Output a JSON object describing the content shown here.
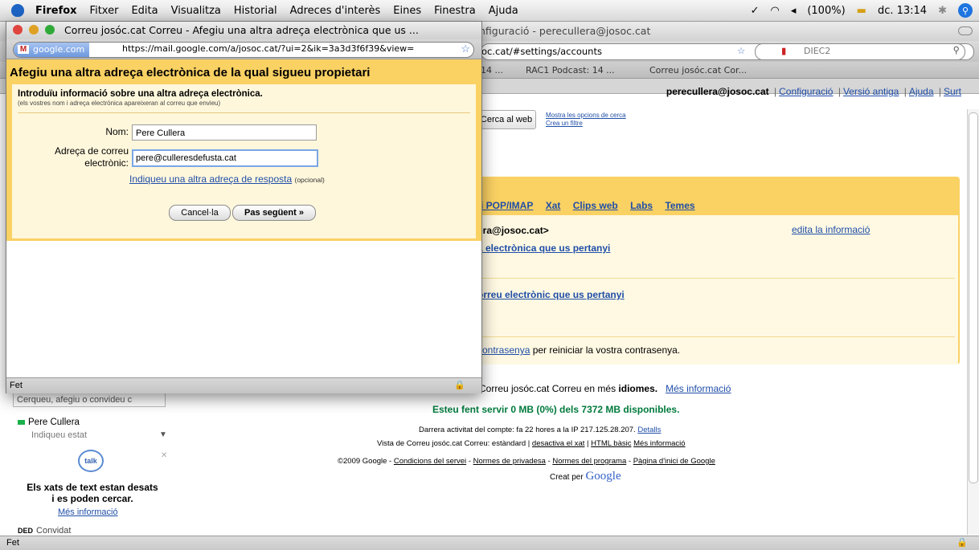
{
  "menubar": {
    "app": "Firefox",
    "items": [
      "Fitxer",
      "Edita",
      "Visualitza",
      "Historial",
      "Adreces d'interès",
      "Eines",
      "Finestra",
      "Ajuda"
    ],
    "battery": "(100%)",
    "clock": "dc. 13:14"
  },
  "back_window": {
    "title_partial": "nfiguració - perecullera@josoc.cat",
    "url_partial": "oc.cat/#settings/accounts",
    "search_placeholder": "DIEC2",
    "bookmarks": [
      "14 ...",
      "RAC1 Podcast: 14 ...",
      "Correu josóc.cat Cor..."
    ],
    "status": "Fet"
  },
  "gmail": {
    "email": "perecullera@josoc.cat",
    "links": [
      "Configuració",
      "Versió antiga",
      "Ajuda",
      "Surt"
    ],
    "search_web_button": "Cerca al web",
    "search_options": [
      "Mostra les opcions de cerca",
      "Crea un filtre"
    ],
    "settings_tabs": [
      "i POP/IMAP",
      "Xat",
      "Clips web",
      "Labs",
      "Temes"
    ],
    "sender_partial": "era@josoc.cat>",
    "edit_info": "edita la informació",
    "add_address_partial": "a electrònica que us pertanyi",
    "add_address2_partial": "orreu electrònic que us pertanyi",
    "password_link": "contrasenya",
    "password_text": " per reiniciar la vostra contrasenya.",
    "language_text": "Correu josóc.cat Correu en més ",
    "language_bold": "idiomes.",
    "more_info": "Més informació",
    "space_text": "Esteu fent servir 0 MB (0%) dels 7372 MB disponibles.",
    "activity_text": "Darrera activitat del compte: fa 22 hores a la IP 217.125.28.207.",
    "details_link": "Detalls",
    "view_text": "Vista de Correu josóc.cat Correu: estàndard |",
    "view_links": [
      "desactiva el xat",
      "HTML bàsic",
      "Més informació"
    ],
    "footer_copyright": "©2009 Google -",
    "footer_links": [
      "Condicions del servei",
      "Normes de privadesa",
      "Normes del programa",
      "Pàgina d'inici de Google"
    ],
    "created_by": "Creat per",
    "google_logo": "Google"
  },
  "chat": {
    "search_placeholder": "Cerqueu, afegiu o convideu c",
    "me": "Pere Cullera",
    "status": "Indiqueu estat",
    "talk": "talk",
    "disabled_line1": "Els xats de text estan desats",
    "disabled_line2": "i es poden cercar.",
    "more_info": "Més informació",
    "invited_tag": "DED",
    "invited": "Convidat"
  },
  "front_window": {
    "title": "Correu josóc.cat Correu - Afegiu una altra adreça electrònica que us ...",
    "site": "google.com",
    "url": "https://mail.google.com/a/josoc.cat/?ui=2&ik=3a3d3f6f39&view=",
    "dialog_title": "Afegiu una altra adreça electrònica de la qual sigueu propietari",
    "intro_heading": "Introduïu informació sobre una altra adreça electrònica.",
    "intro_sub": "(els vostres nom i adreça electrònica apareixeran al correu que envieu)",
    "name_label": "Nom:",
    "name_value": "Pere Cullera",
    "email_label_1": "Adreça de correu",
    "email_label_2": "electrònic:",
    "email_value": "pere@culleresdefusta.cat",
    "reply_link": "Indiqueu una altra adreça de resposta",
    "reply_optional": "(opcional)",
    "cancel_button": "Cancel·la",
    "next_button": "Pas següent »",
    "status": "Fet"
  }
}
